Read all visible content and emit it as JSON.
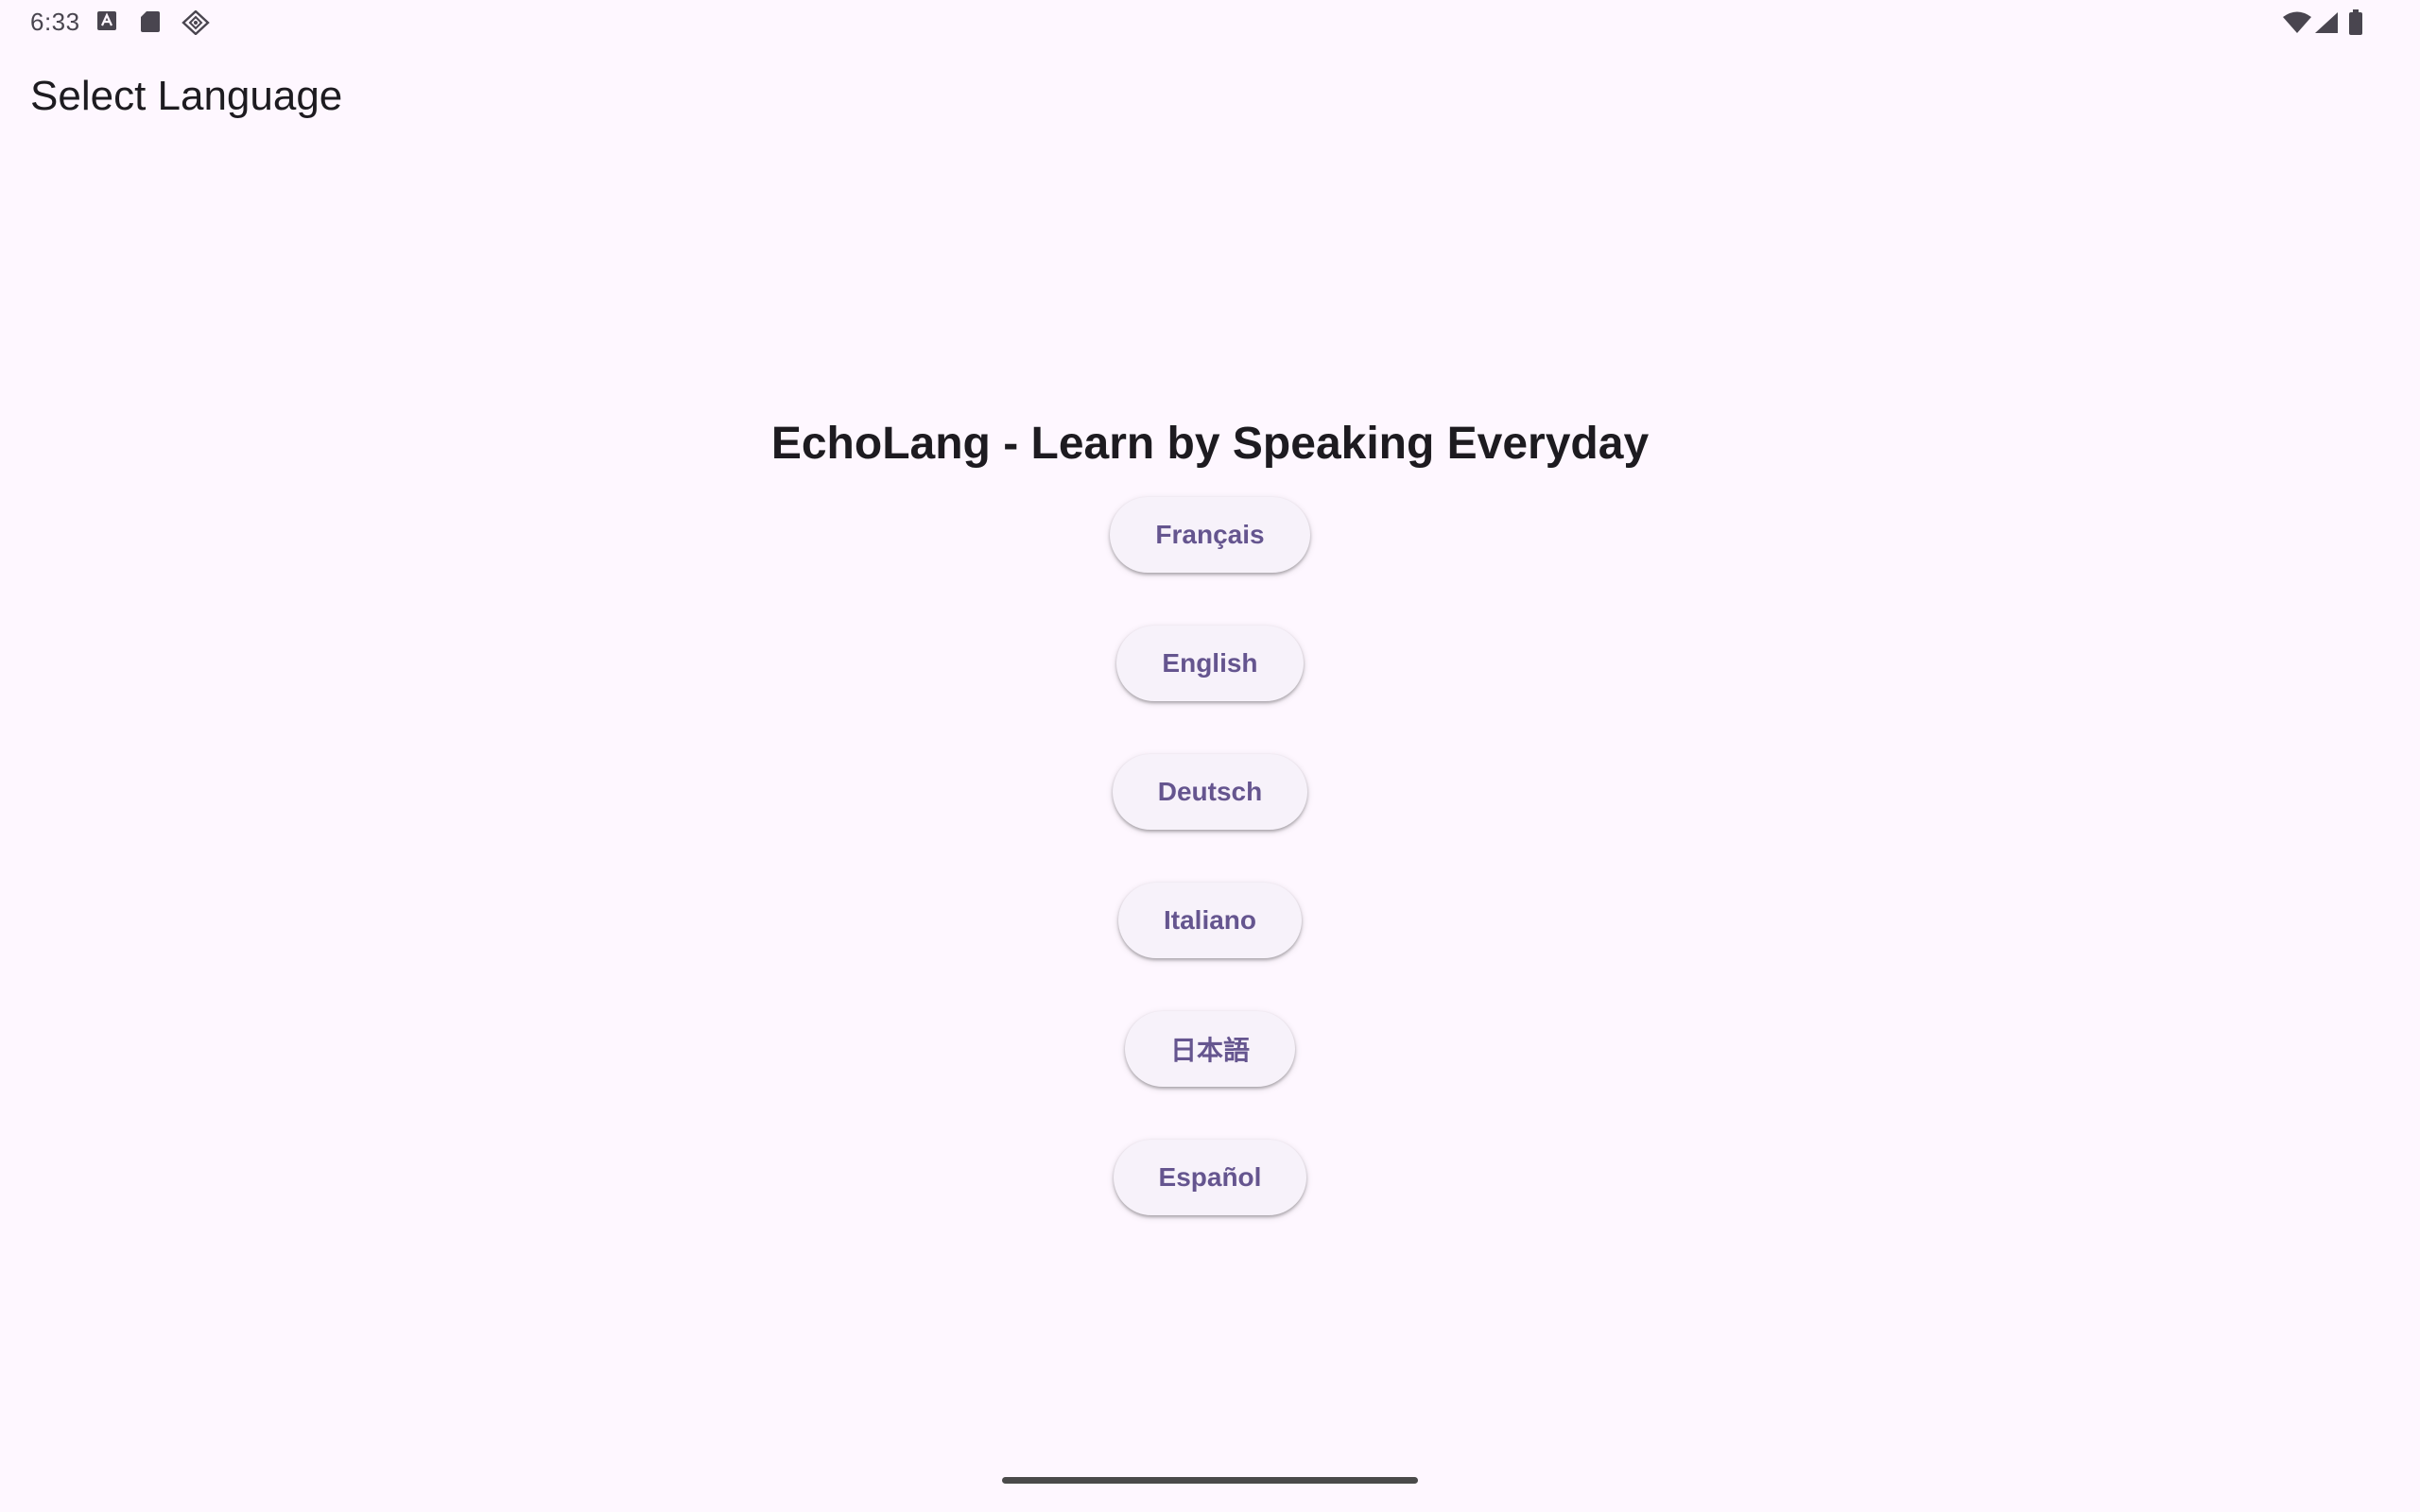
{
  "status_bar": {
    "time": "6:33",
    "left_icons": [
      "keyboard-icon",
      "sd-card-icon",
      "location-diamond-icon"
    ],
    "right_icons": [
      "wifi-icon",
      "cell-signal-icon",
      "battery-icon"
    ]
  },
  "app_bar": {
    "title": "Select Language"
  },
  "main": {
    "headline": "EchoLang - Learn by Speaking Everyday",
    "languages": [
      {
        "label": "Français"
      },
      {
        "label": "English"
      },
      {
        "label": "Deutsch"
      },
      {
        "label": "Italiano"
      },
      {
        "label": "日本語"
      },
      {
        "label": "Español"
      }
    ]
  },
  "colors": {
    "background": "#fef7ff",
    "button_surface": "#f7f2fa",
    "button_text": "#65558f",
    "text": "#1d1b20"
  }
}
